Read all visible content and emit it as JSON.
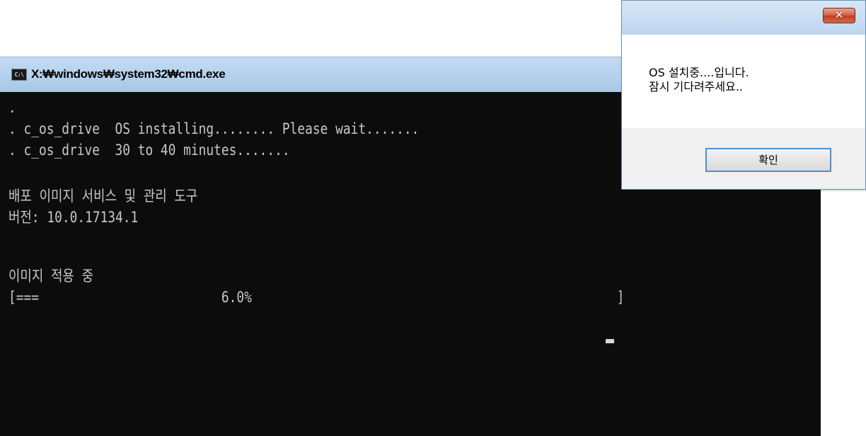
{
  "cmd": {
    "title": "X:₩windows₩system32₩cmd.exe",
    "icon": "cmd-icon",
    "icon_label": "C:\\",
    "lines": [
      ".",
      ". c_os_drive  OS installing........ Please wait.......",
      ". c_os_drive  30 to 40 minutes.......",
      "",
      "배포 이미지 서비스 및 관리 도구",
      "버전: 10.0.17134.1",
      "",
      "이미지 적용 중",
      "[===                        6.0%                                                ]"
    ],
    "progress_percent": 6.0
  },
  "dialog": {
    "message_line1": "OS 설치중....입니다.",
    "message_line2": "잠시 기다려주세요..",
    "ok_label": "확인",
    "close_label": "✕",
    "close_icon": "close-icon"
  },
  "colors": {
    "console_bg": "#0c0c0c",
    "console_text": "#c8c8c8",
    "close_button": "#c94a2e",
    "ok_focus_border": "#4b8fd1"
  }
}
